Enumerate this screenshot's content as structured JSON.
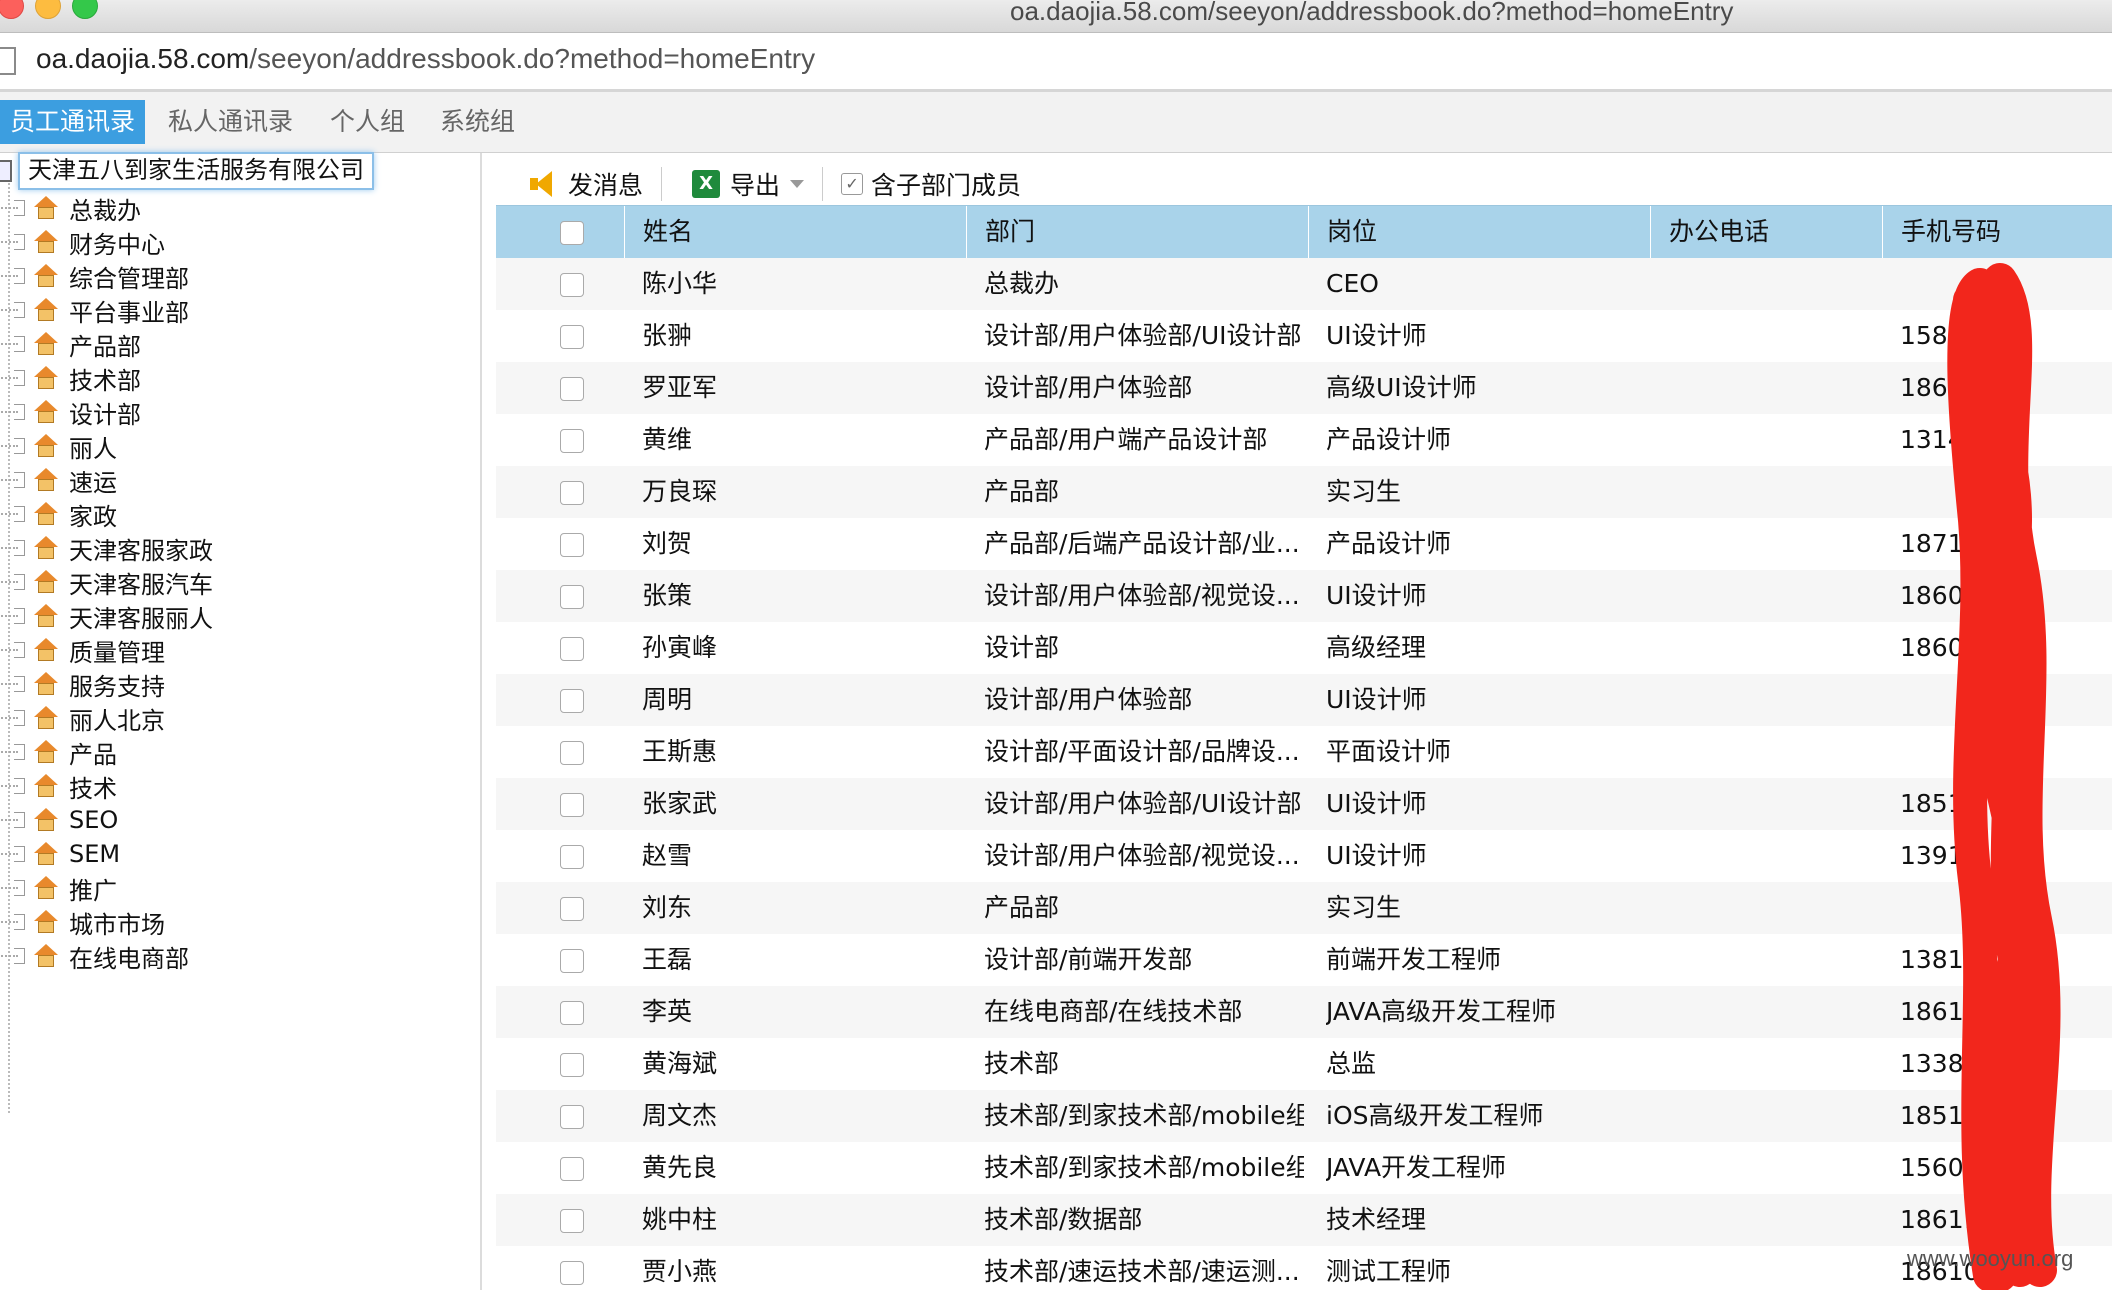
{
  "window": {
    "title": "oa.daojia.58.com/seeyon/addressbook.do?method=homeEntry"
  },
  "urlbar": {
    "host": "oa.daojia.58.com",
    "path": "/seeyon/addressbook.do?method=homeEntry"
  },
  "tabs": [
    {
      "label": "员工通讯录",
      "active": true
    },
    {
      "label": "私人通讯录",
      "active": false
    },
    {
      "label": "个人组",
      "active": false
    },
    {
      "label": "系统组",
      "active": false
    }
  ],
  "tree": {
    "root": "天津五八到家生活服务有限公司",
    "items": [
      "总裁办",
      "财务中心",
      "综合管理部",
      "平台事业部",
      "产品部",
      "技术部",
      "设计部",
      "丽人",
      "速运",
      "家政",
      "天津客服家政",
      "天津客服汽车",
      "天津客服丽人",
      "质量管理",
      "服务支持",
      "丽人北京",
      "产品",
      "技术",
      "SEO",
      "SEM",
      "推广",
      "城市市场",
      "在线电商部"
    ]
  },
  "toolbar": {
    "send_message": "发消息",
    "export": "导出",
    "include_sub": "含子部门成员"
  },
  "grid": {
    "columns": [
      "姓名",
      "部门",
      "岗位",
      "办公电话",
      "手机号码"
    ],
    "rows": [
      {
        "name": "陈小华",
        "dept": "总裁办",
        "post": "CEO",
        "office": "",
        "mobile": ""
      },
      {
        "name": "张翀",
        "dept": "设计部/用户体验部/UI设计部",
        "post": "UI设计师",
        "office": "",
        "mobile": "1581"
      },
      {
        "name": "罗亚军",
        "dept": "设计部/用户体验部",
        "post": "高级UI设计师",
        "office": "",
        "mobile": "1861"
      },
      {
        "name": "黄维",
        "dept": "产品部/用户端产品设计部",
        "post": "产品设计师",
        "office": "",
        "mobile": "1314"
      },
      {
        "name": "万良琛",
        "dept": "产品部",
        "post": "实习生",
        "office": "",
        "mobile": ""
      },
      {
        "name": "刘贺",
        "dept": "产品部/后端产品设计部/业...",
        "post": "产品设计师",
        "office": "",
        "mobile": "18710"
      },
      {
        "name": "张策",
        "dept": "设计部/用户体验部/视觉设...",
        "post": "UI设计师",
        "office": "",
        "mobile": "18600"
      },
      {
        "name": "孙寅峰",
        "dept": "设计部",
        "post": "高级经理",
        "office": "",
        "mobile": "18601"
      },
      {
        "name": "周明",
        "dept": "设计部/用户体验部",
        "post": "UI设计师",
        "office": "",
        "mobile": ""
      },
      {
        "name": "王斯惠",
        "dept": "设计部/平面设计部/品牌设...",
        "post": "平面设计师",
        "office": "",
        "mobile": ""
      },
      {
        "name": "张家武",
        "dept": "设计部/用户体验部/UI设计部",
        "post": "UI设计师",
        "office": "",
        "mobile": "1851"
      },
      {
        "name": "赵雪",
        "dept": "设计部/用户体验部/视觉设...",
        "post": "UI设计师",
        "office": "",
        "mobile": "1391"
      },
      {
        "name": "刘东",
        "dept": "产品部",
        "post": "实习生",
        "office": "",
        "mobile": ""
      },
      {
        "name": "王磊",
        "dept": "设计部/前端开发部",
        "post": "前端开发工程师",
        "office": "",
        "mobile": "13811"
      },
      {
        "name": "李英",
        "dept": "在线电商部/在线技术部",
        "post": "JAVA高级开发工程师",
        "office": "",
        "mobile": "18612"
      },
      {
        "name": "黄海斌",
        "dept": "技术部",
        "post": "总监",
        "office": "",
        "mobile": "13381"
      },
      {
        "name": "周文杰",
        "dept": "技术部/到家技术部/mobile组",
        "post": "iOS高级开发工程师",
        "office": "",
        "mobile": "18511"
      },
      {
        "name": "黄先良",
        "dept": "技术部/到家技术部/mobile组",
        "post": "JAVA开发工程师",
        "office": "",
        "mobile": "15600"
      },
      {
        "name": "姚中柱",
        "dept": "技术部/数据部",
        "post": "技术经理",
        "office": "",
        "mobile": "18611"
      },
      {
        "name": "贾小燕",
        "dept": "技术部/速运技术部/速运测...",
        "post": "测试工程师",
        "office": "",
        "mobile": "18610"
      }
    ]
  },
  "watermark": "www.wooyun.org",
  "colors": {
    "active_tab": "#3c9ee0",
    "grid_header": "#a9d3ea",
    "redaction": "#f2261c"
  }
}
